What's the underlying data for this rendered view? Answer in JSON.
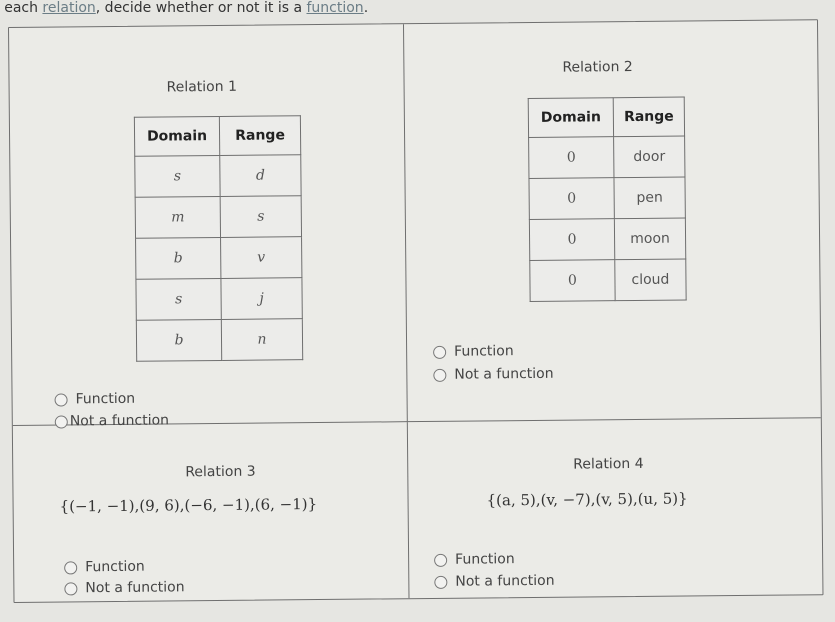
{
  "instructions": {
    "prefix": "r each ",
    "link1": "relation",
    "middle": ", decide whether or not it is a ",
    "link2": "function",
    "suffix": "."
  },
  "relations": [
    {
      "title": "Relation 1",
      "type": "table",
      "headers": [
        "Domain",
        "Range"
      ],
      "rows": [
        [
          "s",
          "d"
        ],
        [
          "m",
          "s"
        ],
        [
          "b",
          "v"
        ],
        [
          "s",
          "j"
        ],
        [
          "b",
          "n"
        ]
      ],
      "options": [
        "Function",
        "Not a function"
      ]
    },
    {
      "title": "Relation 2",
      "type": "table",
      "headers": [
        "Domain",
        "Range"
      ],
      "rows": [
        [
          "0",
          "door"
        ],
        [
          "0",
          "pen"
        ],
        [
          "0",
          "moon"
        ],
        [
          "0",
          "cloud"
        ]
      ],
      "options": [
        "Function",
        "Not a function"
      ]
    },
    {
      "title": "Relation 3",
      "type": "set",
      "set_text": "{(−1, −1),(9, 6),(−6, −1),(6, −1)}",
      "options": [
        "Function",
        "Not a function"
      ]
    },
    {
      "title": "Relation 4",
      "type": "set",
      "set_text": "{(a, 5),(v, −7),(v, 5),(u, 5)}",
      "options": [
        "Function",
        "Not a function"
      ]
    }
  ]
}
